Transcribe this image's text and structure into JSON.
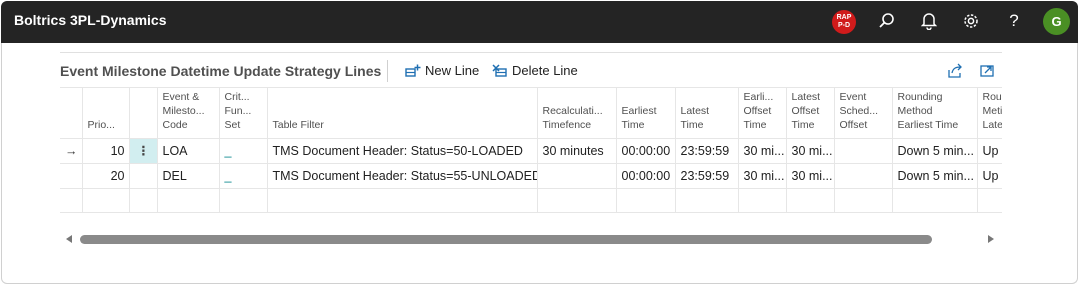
{
  "app": {
    "title": "Boltrics 3PL-Dynamics"
  },
  "topbar": {
    "badge_line1": "RAP",
    "badge_line2": "P-D",
    "avatar_initial": "G",
    "help_label": "?"
  },
  "part": {
    "title": "Event Milestone Datetime Update Strategy Lines",
    "actions": {
      "new_line": "New Line",
      "delete_line": "Delete Line"
    }
  },
  "grid": {
    "headers": {
      "priority": [
        "Prio..."
      ],
      "event_code": [
        "Event &",
        "Milesto...",
        "Code"
      ],
      "crit_fun": [
        "Crit...",
        "Fun...",
        "Set"
      ],
      "table_filter": [
        "Table Filter"
      ],
      "recalc": [
        "Recalculati...",
        "Timefence"
      ],
      "earliest_time": [
        "Earliest",
        "Time"
      ],
      "latest_time": [
        "Latest",
        "Time"
      ],
      "earliest_offset": [
        "Earli...",
        "Offset",
        "Time"
      ],
      "latest_offset": [
        "Latest",
        "Offset",
        "Time"
      ],
      "event_sched": [
        "Event",
        "Sched...",
        "Offset"
      ],
      "rounding_earliest": [
        "Rounding",
        "Method",
        "Earliest Time"
      ],
      "rounding_latest": [
        "Rour",
        "Meti",
        "Late"
      ]
    },
    "rows": [
      {
        "indicator": "→",
        "menu": "⋮",
        "priority": "10",
        "event_code": "LOA",
        "crit_fun": "_",
        "table_filter": "TMS Document Header: Status=50-LOADED",
        "recalc": "30 minutes",
        "earliest_time": "00:00:00",
        "latest_time": "23:59:59",
        "earliest_offset": "30 mi...",
        "latest_offset": "30 mi...",
        "event_sched": "",
        "rounding_earliest": "Down 5 min...",
        "rounding_latest": "Up"
      },
      {
        "indicator": "",
        "menu": "",
        "priority": "20",
        "event_code": "DEL",
        "crit_fun": "_",
        "table_filter": "TMS Document Header: Status=55-UNLOADED",
        "recalc": "",
        "earliest_time": "00:00:00",
        "latest_time": "23:59:59",
        "earliest_offset": "30 mi...",
        "latest_offset": "30 mi...",
        "event_sched": "",
        "rounding_earliest": "Down 5 min...",
        "rounding_latest": "Up"
      }
    ]
  },
  "colors": {
    "topbar": "#242424",
    "accent_teal": "#00838a",
    "badge_red": "#d01b1b",
    "avatar_green": "#4a8f24",
    "selected_cell": "#d2eef0"
  }
}
